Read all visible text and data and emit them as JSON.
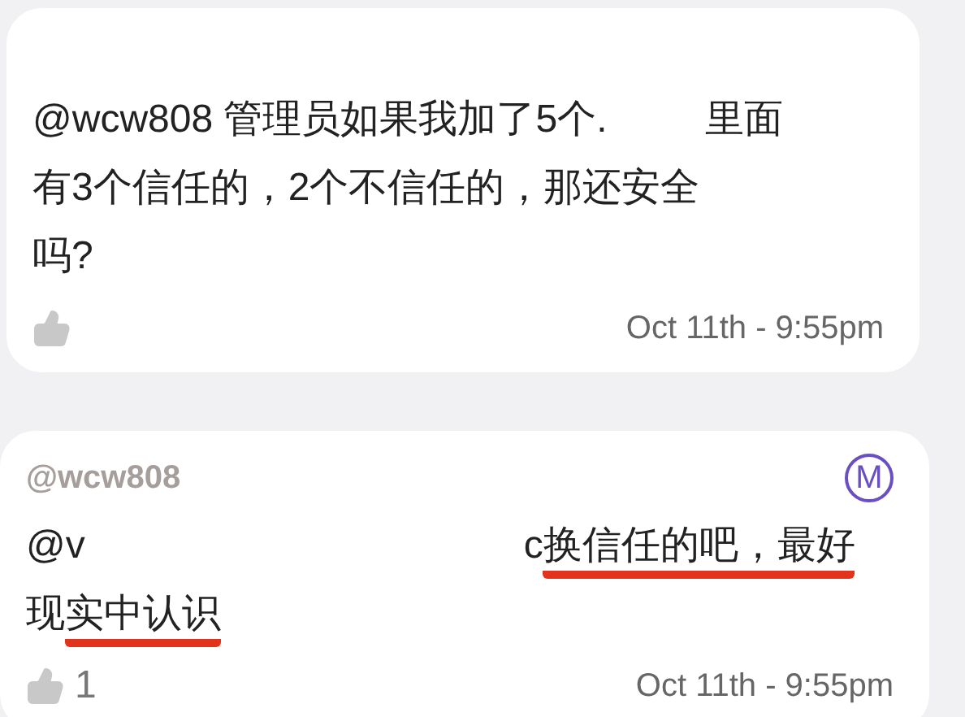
{
  "messages": [
    {
      "segments": [
        {
          "kind": "text",
          "text": "@wcw808 管理员如果我加了5个.",
          "underlined": false
        },
        {
          "kind": "redacted"
        },
        {
          "kind": "text",
          "text": "里面",
          "underlined": false
        },
        {
          "kind": "break"
        },
        {
          "kind": "text",
          "text": "有3个信任的，2个不信任的，那还安全",
          "underlined": false
        },
        {
          "kind": "break"
        },
        {
          "kind": "text",
          "text": "吗?",
          "underlined": false
        }
      ],
      "time": "Oct 11th - 9:55pm"
    },
    {
      "author": "@wcw808",
      "badge": "M",
      "segments": [
        {
          "kind": "text",
          "text": "@v",
          "underlined": false
        },
        {
          "kind": "redacted"
        },
        {
          "kind": "text",
          "text": "c ",
          "underlined": false
        },
        {
          "kind": "text",
          "text": "换信任的吧，最好",
          "underlined": true
        },
        {
          "kind": "break"
        },
        {
          "kind": "text",
          "text": "现",
          "underlined": false
        },
        {
          "kind": "text",
          "text": "实中认识",
          "underlined": true
        }
      ],
      "likes": "1",
      "time": "Oct 11th - 9:55pm"
    }
  ]
}
